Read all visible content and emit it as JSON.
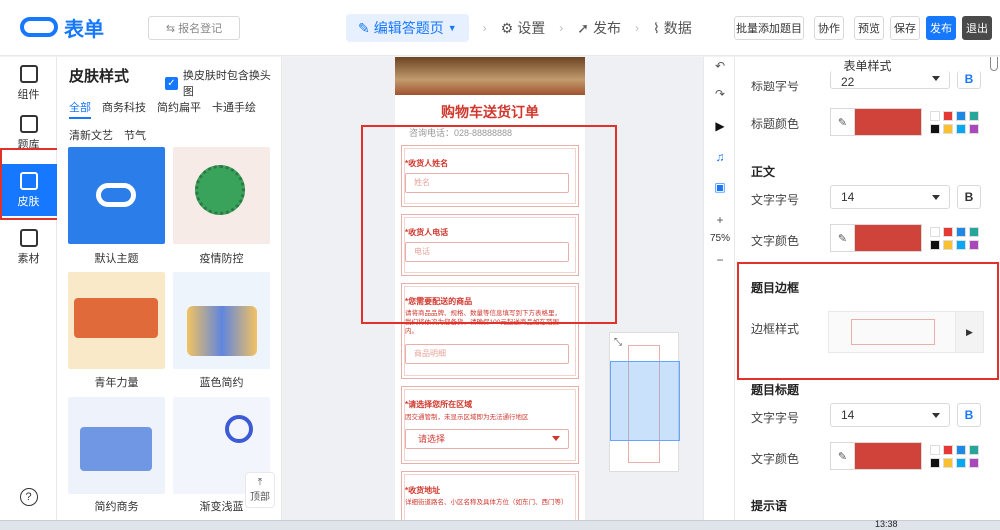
{
  "header": {
    "logo_text": "表单",
    "form_register_btn": "⇆ 报名登记",
    "steps": [
      "编辑答题页",
      "设置",
      "发布",
      "数据"
    ],
    "buttons": {
      "batch_add": "批量添加题目",
      "collaborate": "协作",
      "preview": "预览",
      "save": "保存",
      "publish": "发布",
      "exit": "退出"
    }
  },
  "nav": {
    "items": [
      "组件",
      "题库",
      "皮肤",
      "素材"
    ],
    "active": "皮肤",
    "help": "?"
  },
  "skin_panel": {
    "title": "皮肤样式",
    "checkbox_label": "换皮肤时包含换头图",
    "categories": [
      "全部",
      "商务科技",
      "简约扁平",
      "卡通手绘",
      "清新文艺",
      "节气"
    ],
    "active_category": "全部",
    "thumbs": [
      {
        "label": "默认主题"
      },
      {
        "label": "疫情防控"
      },
      {
        "label": "青年力量"
      },
      {
        "label": "蓝色简约"
      },
      {
        "label": "简约商务"
      },
      {
        "label": "渐变浅蓝"
      }
    ],
    "top_button": "顶部"
  },
  "form_preview": {
    "title": "购物车送货订单",
    "phone_line": "咨询电话：028-88888888",
    "questions": [
      {
        "label": "*收货人姓名",
        "placeholder": "姓名"
      },
      {
        "label": "*收货人电话",
        "placeholder": "电话"
      },
      {
        "label": "*您需要配送的商品",
        "hint": "请将商品品牌、规格、数量等信息填写到下方表格里，我们将依次为您备货，请确保100元起送商品如在范围内。",
        "placeholder": "商品明细"
      },
      {
        "label": "*请选择您所在区域",
        "hint": "因交通管制，未显示区域即为无法通行地区",
        "select": "请选择"
      },
      {
        "label": "*收货地址",
        "hint": "详细街道路名、小区名称及具体方位（如东门、西门等）"
      }
    ]
  },
  "side_tools": {
    "zoom": "75%",
    "plus": "+",
    "minus": "−"
  },
  "props": {
    "panel_title": "表单样式",
    "title_size_label": "标题字号",
    "title_size_value": "22",
    "title_color_label": "标题颜色",
    "body_section": "正文",
    "body_size_label": "文字字号",
    "body_size_value": "14",
    "body_color_label": "文字颜色",
    "border_section": "题目边框",
    "border_style_label": "边框样式",
    "qtitle_section": "题目标题",
    "qtitle_size_label": "文字字号",
    "qtitle_size_value": "14",
    "qtitle_color_label": "文字颜色",
    "hint_section": "提示语",
    "bold_label": "B",
    "accent_color": "#d0433a",
    "swatch_colors": [
      "#ffffff",
      "#e53935",
      "#1e88e5",
      "#26a69a",
      "#111111",
      "#fbc02d",
      "#03a9f4",
      "#ab47bc"
    ]
  },
  "taskbar": {
    "time": "13:38"
  }
}
